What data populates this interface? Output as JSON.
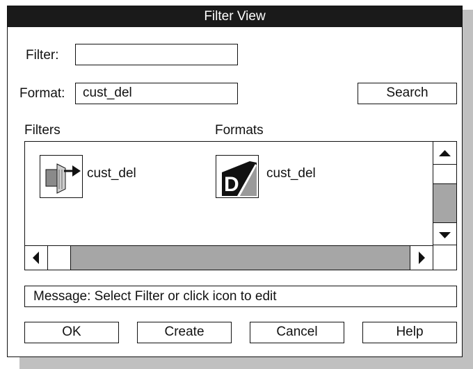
{
  "window": {
    "title": "Filter View"
  },
  "filter_field": {
    "label": "Filter:",
    "value": ""
  },
  "format_field": {
    "label": "Format:",
    "value": "cust_del"
  },
  "search_button": {
    "label": "Search"
  },
  "columns": {
    "filters": "Filters",
    "formats": "Formats"
  },
  "items": {
    "filter_item": {
      "label": "cust_del",
      "icon": "filter-arrow-icon"
    },
    "format_item": {
      "label": "cust_del",
      "icon": "format-d-icon"
    }
  },
  "message": "Message: Select Filter or click icon to edit",
  "buttons": {
    "ok": "OK",
    "create": "Create",
    "cancel": "Cancel",
    "help": "Help"
  },
  "colors": {
    "titlebar": "#1a1a1a",
    "scroll_track": "#a6a6a6",
    "shadow": "#c0c0c0"
  }
}
